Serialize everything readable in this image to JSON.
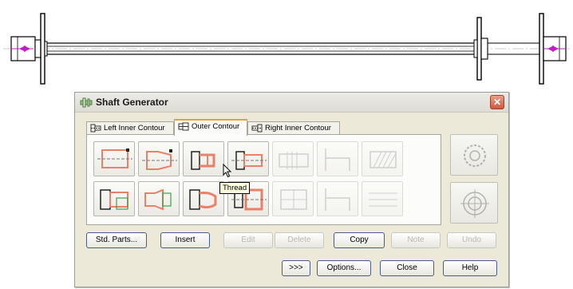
{
  "dialog": {
    "title": "Shaft Generator",
    "close_glyph": "✕"
  },
  "tabs": [
    {
      "label": "Left Inner Contour",
      "active": false
    },
    {
      "label": "Outer Contour",
      "active": true
    },
    {
      "label": "Right Inner Contour",
      "active": false
    }
  ],
  "feature_buttons": [
    {
      "name": "cylinder-feature-button",
      "enabled": true
    },
    {
      "name": "cone-feature-button",
      "enabled": true
    },
    {
      "name": "thread-feature-button",
      "enabled": true
    },
    {
      "name": "chamfer-feature-button",
      "enabled": true
    },
    {
      "name": "groove-feature-button",
      "enabled": false
    },
    {
      "name": "step-feature-button",
      "enabled": false
    },
    {
      "name": "knurl-feature-button",
      "enabled": false
    },
    {
      "name": "keyway-feature-button",
      "enabled": true
    },
    {
      "name": "profile-feature-button",
      "enabled": true
    },
    {
      "name": "spline-feature-button",
      "enabled": true
    },
    {
      "name": "relief-feature-button",
      "enabled": true
    },
    {
      "name": "undercut-feature-button",
      "enabled": false
    },
    {
      "name": "shoulder-feature-button",
      "enabled": false
    },
    {
      "name": "hatch-feature-button",
      "enabled": false
    }
  ],
  "tooltip": {
    "text": "Thread"
  },
  "buttons": {
    "std_parts": "Std. Parts...",
    "insert": "Insert",
    "edit": "Edit",
    "delete": "Delete",
    "copy": "Copy",
    "note": "Note",
    "undo": "Undo",
    "more": ">>>",
    "options": "Options...",
    "close": "Close",
    "help": "Help"
  },
  "colors": {
    "feature_accent": "#e8806a",
    "feature_green": "#3aa64a",
    "dimension_magenta": "#c020c0"
  }
}
